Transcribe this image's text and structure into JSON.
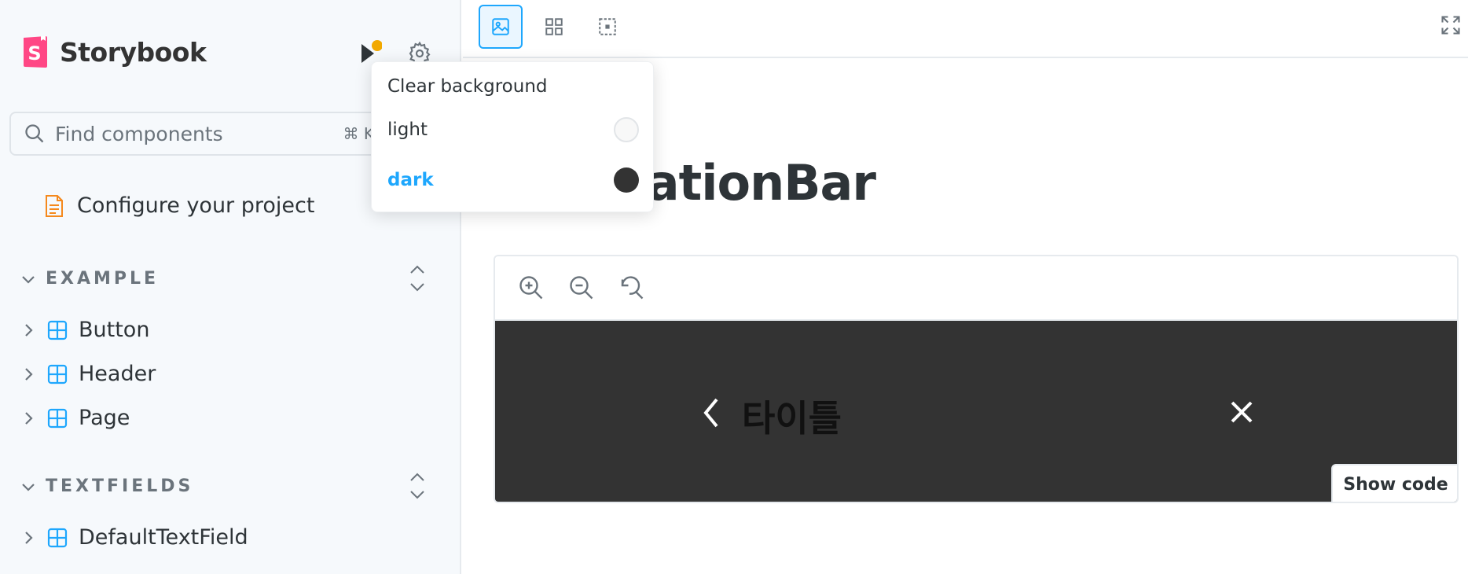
{
  "sidebar": {
    "brand": "Storybook",
    "search": {
      "placeholder": "Find components",
      "shortcut": "⌘ K"
    },
    "doc_item": "Configure your project",
    "groups": [
      {
        "label": "EXAMPLE",
        "items": [
          "Button",
          "Header",
          "Page"
        ]
      },
      {
        "label": "TEXTFIELDS",
        "items": [
          "DefaultTextField"
        ]
      }
    ]
  },
  "background_menu": {
    "items": [
      {
        "label": "Clear background"
      },
      {
        "label": "light",
        "color": "#f8f8f8"
      },
      {
        "label": "dark",
        "color": "#333333",
        "selected": true
      }
    ]
  },
  "main": {
    "title": "NavigationBar",
    "preview": {
      "nav_title": "타이틀",
      "background": "#333333"
    },
    "show_code": "Show code"
  },
  "colors": {
    "accent": "#1ea7fd",
    "brand": "#ff4785",
    "status_dot": "#f2a900",
    "component_icon": "#1ea7fd",
    "doc_icon": "#f5891c"
  }
}
